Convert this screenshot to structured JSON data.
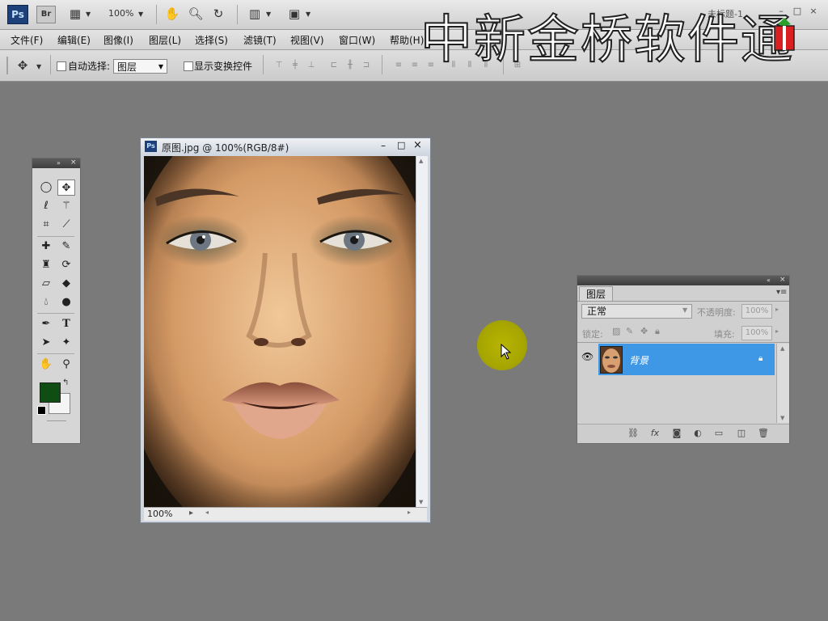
{
  "app": {
    "logo": "Ps",
    "bridge": "Br",
    "zoom": "100%",
    "document_tab": "未标题-1",
    "window_controls": [
      "–",
      "□",
      "×"
    ]
  },
  "toolbar_icons": [
    "screen-mode-icon",
    "hand-icon",
    "zoom-icon",
    "rotate-view-icon",
    "arrange-icon"
  ],
  "menu": [
    "文件(F)",
    "编辑(E)",
    "图像(I)",
    "图层(L)",
    "选择(S)",
    "滤镜(T)",
    "视图(V)",
    "窗口(W)",
    "帮助(H)"
  ],
  "options": {
    "auto_select_label": "自动选择:",
    "auto_select_value": "图层",
    "show_transform_label": "显示变换控件"
  },
  "watermark": "中新金桥软件通",
  "document": {
    "title": "原图.jpg @ 100%(RGB/8#)",
    "status_zoom": "100%"
  },
  "colors": {
    "foreground": "#104d13",
    "background": "#f4f4f4",
    "layer_selected": "#3e98e6"
  },
  "layers_panel": {
    "tab": "图层",
    "blend_mode": "正常",
    "opacity_label": "不透明度:",
    "opacity_value": "100%",
    "lock_label": "锁定:",
    "fill_label": "填充:",
    "fill_value": "100%",
    "layer_name": "背景"
  }
}
